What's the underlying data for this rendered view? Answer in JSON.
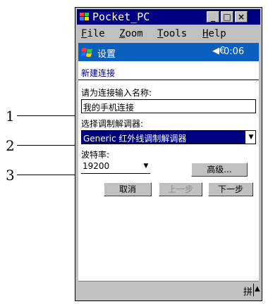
{
  "annotations": [
    "1",
    "2",
    "3"
  ],
  "window": {
    "title": "Pocket_PC",
    "controls": {
      "minimize": "_",
      "maximize": "□",
      "close": "×"
    }
  },
  "menu": [
    {
      "letter": "F",
      "rest": "ile"
    },
    {
      "letter": "Z",
      "rest": "oom"
    },
    {
      "letter": "T",
      "rest": "ools"
    },
    {
      "letter": "H",
      "rest": "elp"
    }
  ],
  "navbar": {
    "title": "设置",
    "volume_icon": "◀€",
    "time": "0:06"
  },
  "page": {
    "heading": "新建连接"
  },
  "form": {
    "name_label": "请为连接输入名称:",
    "name_value": "我的手机连接",
    "modem_label": "选择调制解调器:",
    "modem_value": "Generic 红外线调制解调器",
    "baud_label": "波特率:",
    "baud_value": "19200",
    "advanced_button": "高级..."
  },
  "actions": {
    "cancel": "取消",
    "back": "上一步",
    "next": "下一步"
  },
  "bottom": {
    "ime": "拼",
    "up": "▲"
  },
  "colors": {
    "titlebar": "#000080",
    "navbar": "#0a5fbf",
    "selected": "#000080",
    "chrome": "#c0c0c0"
  }
}
